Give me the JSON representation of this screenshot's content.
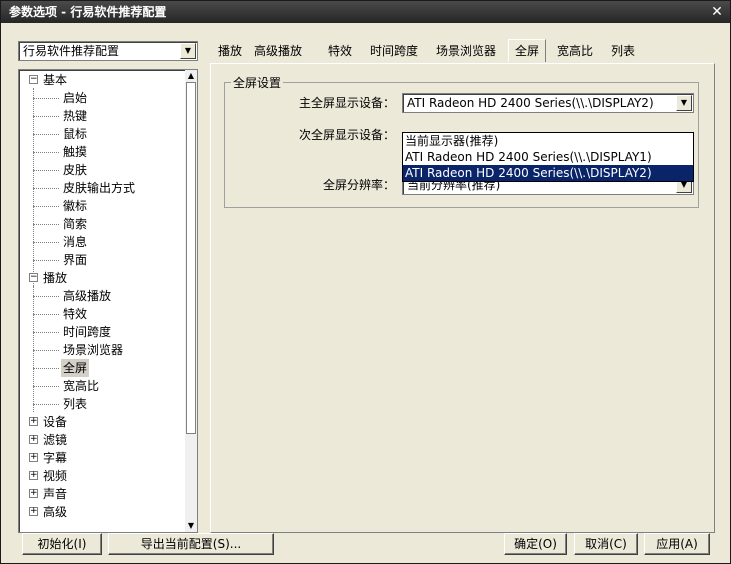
{
  "window": {
    "title": "参数选项 - 行易软件推荐配置",
    "close_glyph": "✕"
  },
  "profile_combo": {
    "value": "行易软件推荐配置",
    "arrow": "▼"
  },
  "tree": {
    "items": [
      {
        "label": "基本",
        "expander": "−",
        "level": 0
      },
      {
        "label": "启始",
        "level": 1
      },
      {
        "label": "热键",
        "level": 1
      },
      {
        "label": "鼠标",
        "level": 1
      },
      {
        "label": "触摸",
        "level": 1
      },
      {
        "label": "皮肤",
        "level": 1
      },
      {
        "label": "皮肤输出方式",
        "level": 1
      },
      {
        "label": "徽标",
        "level": 1
      },
      {
        "label": "简索",
        "level": 1
      },
      {
        "label": "消息",
        "level": 1
      },
      {
        "label": "界面",
        "level": 1
      },
      {
        "label": "播放",
        "expander": "−",
        "level": 0
      },
      {
        "label": "高级播放",
        "level": 1
      },
      {
        "label": "特效",
        "level": 1
      },
      {
        "label": "时间跨度",
        "level": 1
      },
      {
        "label": "场景浏览器",
        "level": 1
      },
      {
        "label": "全屏",
        "level": 1,
        "selected": true
      },
      {
        "label": "宽高比",
        "level": 1
      },
      {
        "label": "列表",
        "level": 1
      },
      {
        "label": "设备",
        "expander": "+",
        "level": 0
      },
      {
        "label": "滤镜",
        "expander": "+",
        "level": 0
      },
      {
        "label": "字幕",
        "expander": "+",
        "level": 0
      },
      {
        "label": "视频",
        "expander": "+",
        "level": 0
      },
      {
        "label": "声音",
        "expander": "+",
        "level": 0
      },
      {
        "label": "高级",
        "expander": "+",
        "level": 0
      }
    ],
    "scroll_up": "▲",
    "scroll_down": "▼"
  },
  "tabs": [
    "播放",
    "高级播放",
    "特效",
    "时间跨度",
    "场景浏览器",
    "全屏",
    "宽高比",
    "列表"
  ],
  "active_tab": "全屏",
  "fullscreen": {
    "group_title": "全屏设置",
    "primary_label": "主全屏显示设备：",
    "primary_value": "ATI Radeon HD 2400 Series(\\\\.\\DISPLAY2)",
    "secondary_label": "次全屏显示设备：",
    "resolution_label": "全屏分辨率：",
    "resolution_value": "当前分辨率(推荐)",
    "dropdown_options": [
      "当前显示器(推荐)",
      "ATI Radeon HD 2400 Series(\\\\.\\DISPLAY1)",
      "ATI Radeon HD 2400 Series(\\\\.\\DISPLAY2)"
    ],
    "dropdown_selected_index": 2
  },
  "buttons": {
    "init": "初始化(I)",
    "export": "导出当前配置(S)...",
    "ok": "确定(O)",
    "cancel": "取消(C)",
    "apply": "应用(A)"
  }
}
